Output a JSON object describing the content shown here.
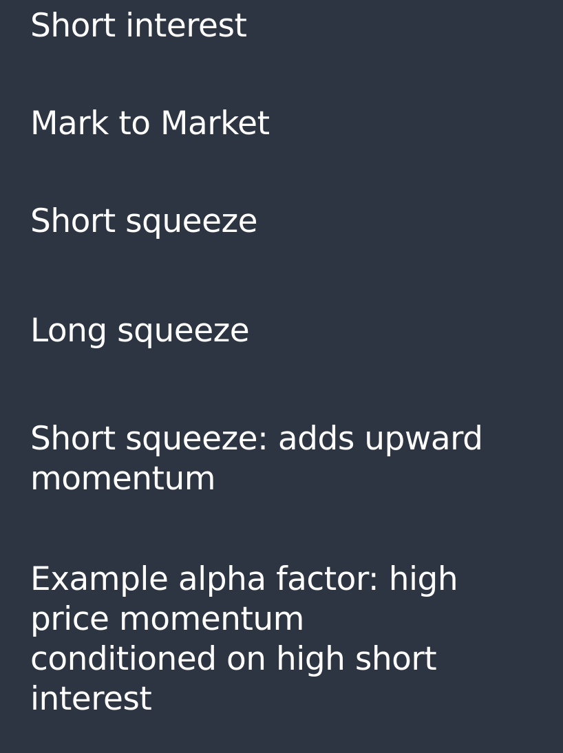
{
  "slide": {
    "items": [
      "Short interest",
      "Mark to Market",
      "Short squeeze",
      "Long squeeze",
      "Short squeeze: adds upward\nmomentum",
      "Example alpha factor: high\nprice momentum\nconditioned on high short\ninterest"
    ]
  }
}
